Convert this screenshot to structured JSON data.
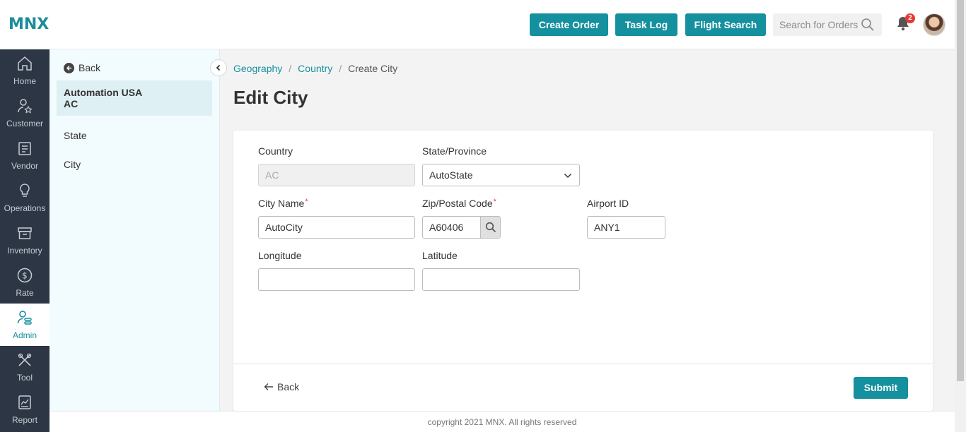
{
  "header": {
    "logo": "MNX",
    "buttons": {
      "create_order": "Create Order",
      "task_log": "Task Log",
      "flight_search": "Flight Search"
    },
    "search_placeholder": "Search for Orders",
    "notification_count": "2",
    "accent_color": "#15909f"
  },
  "leftnav": {
    "items": [
      {
        "label": "Home",
        "icon": "home-icon"
      },
      {
        "label": "Customer",
        "icon": "customer-icon"
      },
      {
        "label": "Vendor",
        "icon": "vendor-icon"
      },
      {
        "label": "Operations",
        "icon": "lightbulb-icon"
      },
      {
        "label": "Inventory",
        "icon": "archive-icon"
      },
      {
        "label": "Rate",
        "icon": "dollar-icon"
      },
      {
        "label": "Admin",
        "icon": "admin-icon",
        "active": true
      },
      {
        "label": "Tool",
        "icon": "tools-icon"
      },
      {
        "label": "Report",
        "icon": "report-icon"
      }
    ]
  },
  "subnav": {
    "back_label": "Back",
    "selected_line1": "Automation USA",
    "selected_line2": "AC",
    "links": [
      "State",
      "City"
    ]
  },
  "breadcrumb": {
    "items": [
      "Geography",
      "Country",
      "Create City"
    ]
  },
  "page_title": "Edit City",
  "form": {
    "country": {
      "label": "Country",
      "value": "AC"
    },
    "state": {
      "label": "State/Province",
      "value": "AutoState"
    },
    "city_name": {
      "label": "City Name",
      "value": "AutoCity",
      "required": "*"
    },
    "zip": {
      "label": "Zip/Postal Code",
      "value": "A60406",
      "required": "*"
    },
    "airport_id": {
      "label": "Airport ID",
      "value": "ANY1"
    },
    "longitude": {
      "label": "Longitude",
      "value": ""
    },
    "latitude": {
      "label": "Latitude",
      "value": ""
    },
    "back_label": "Back",
    "submit_label": "Submit"
  },
  "footer": "copyright 2021 MNX. All rights reserved"
}
